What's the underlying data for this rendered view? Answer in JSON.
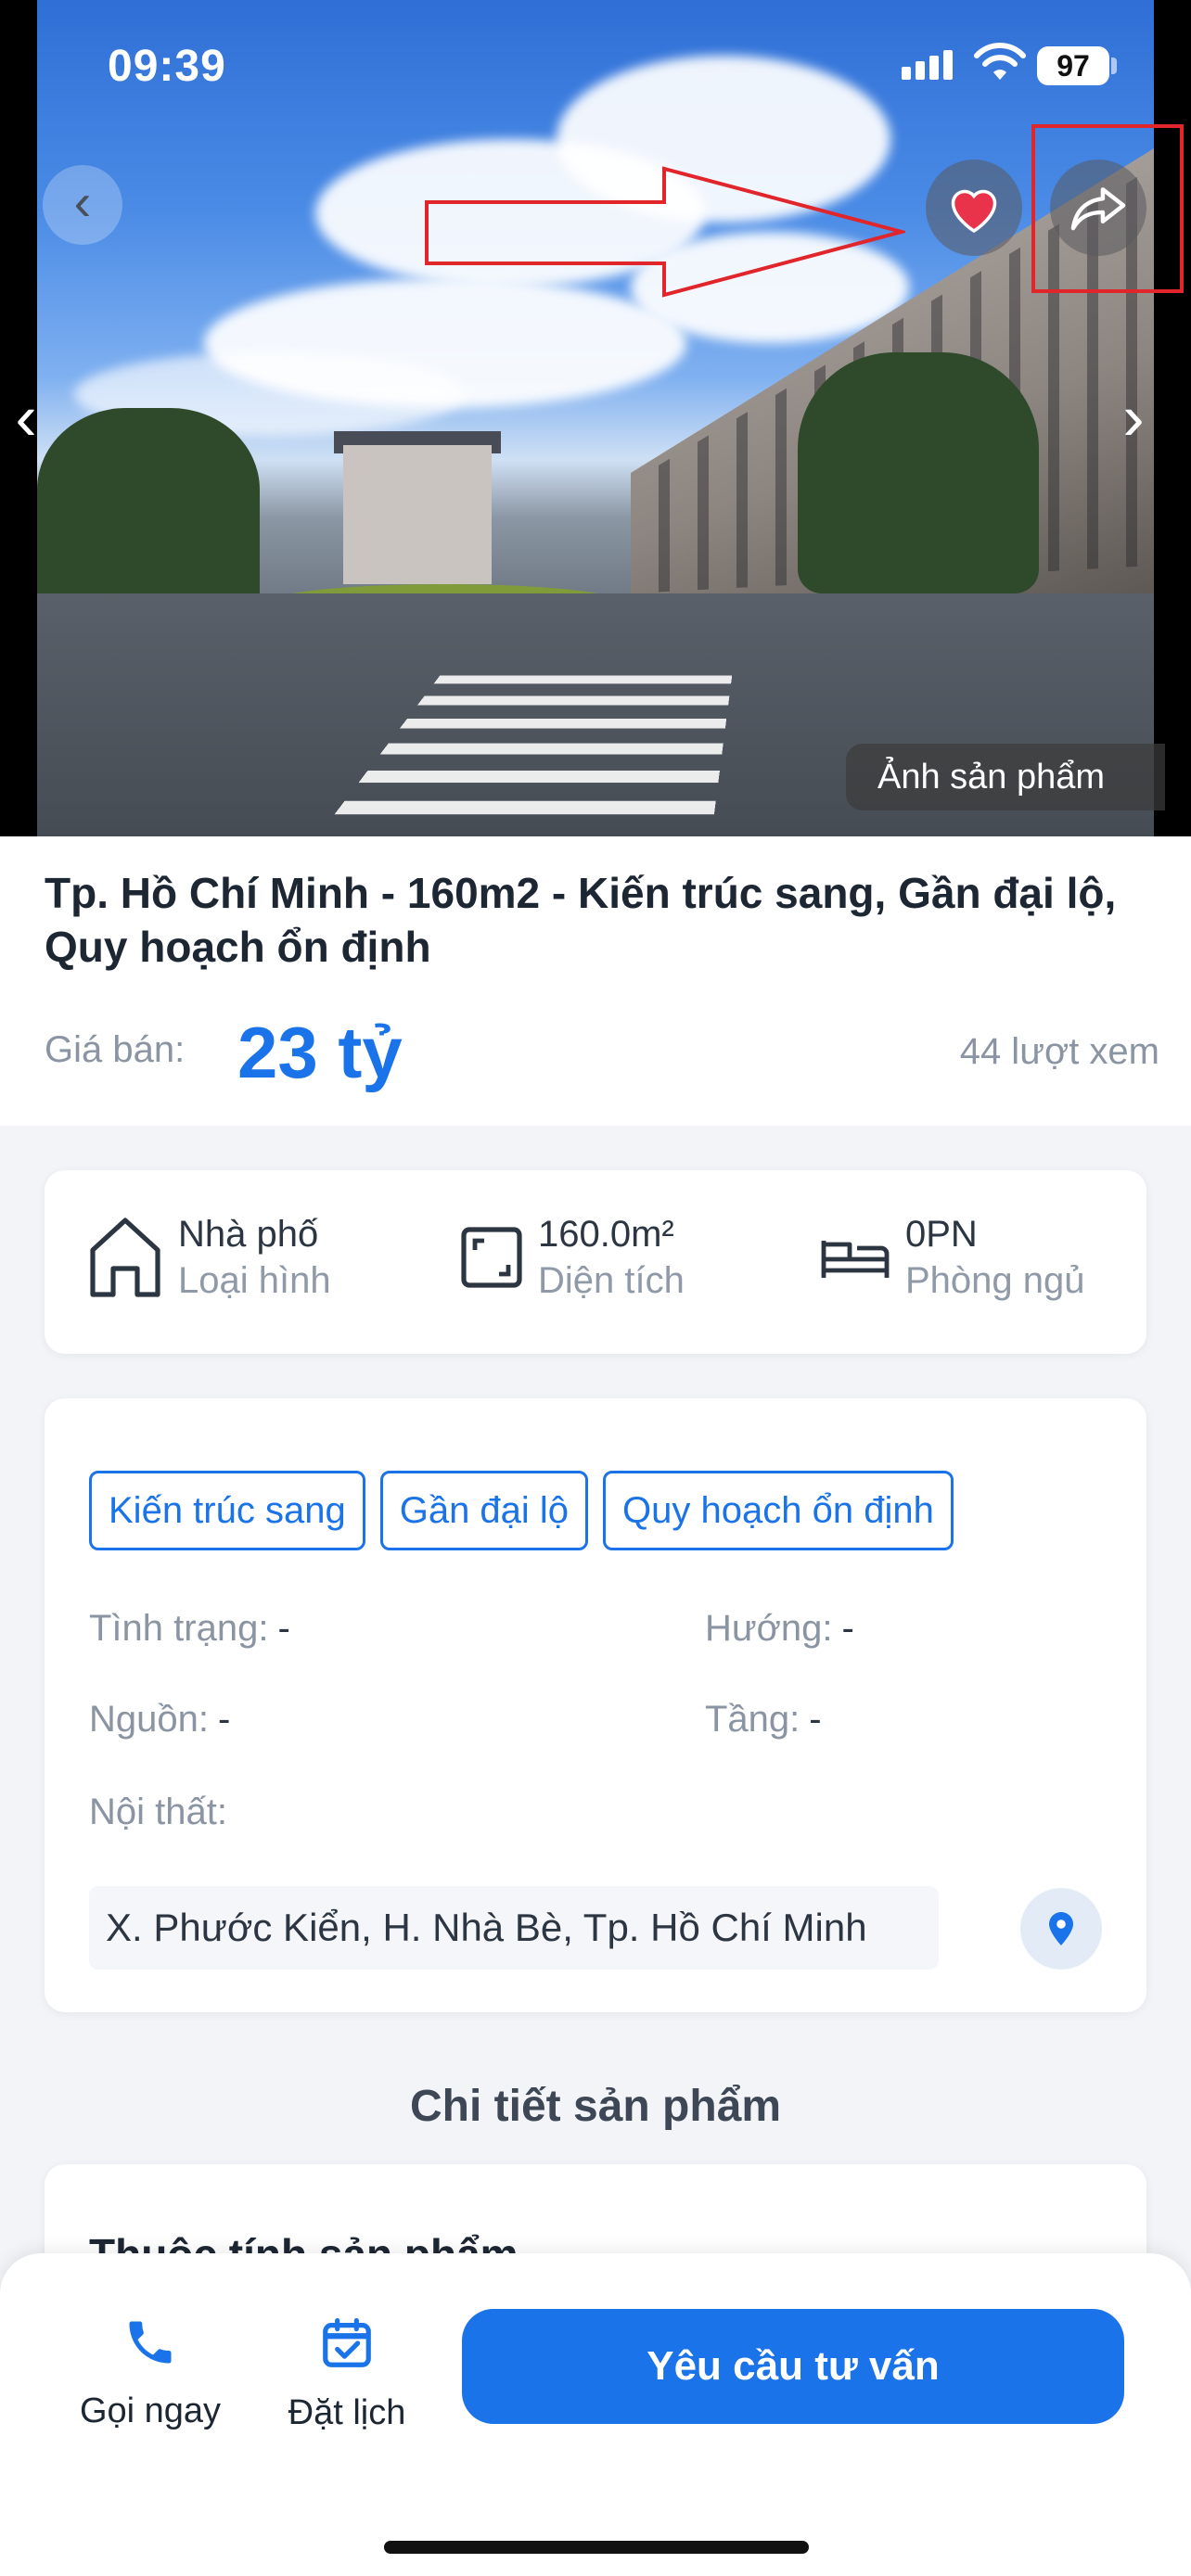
{
  "status_bar": {
    "time": "09:39",
    "battery": "97"
  },
  "hero": {
    "photo_label": "Ảnh sản phẩm"
  },
  "listing": {
    "title": "Tp. Hồ Chí Minh - 160m2 - Kiến trúc sang, Gần đại lộ, Quy hoạch ổn định",
    "price_label": "Giá bán:",
    "price": "23 tỷ",
    "views": "44 lượt xem"
  },
  "specs": [
    {
      "value": "Nhà phố",
      "label": "Loại hình",
      "icon": "house-icon"
    },
    {
      "value": "160.0m²",
      "label": "Diện tích",
      "icon": "area-icon"
    },
    {
      "value": "0PN",
      "label": "Phòng ngủ",
      "icon": "bed-icon"
    }
  ],
  "tags": [
    "Kiến trúc sang",
    "Gần đại lộ",
    "Quy hoạch ổn định"
  ],
  "attributes": {
    "status_label": "Tình trạng:",
    "status_value": "-",
    "direction_label": "Hướng:",
    "direction_value": "-",
    "source_label": "Nguồn:",
    "source_value": "-",
    "floor_label": "Tầng:",
    "floor_value": "-",
    "furniture_label": "Nội thất:"
  },
  "address": "X. Phước Kiển, H. Nhà Bè, Tp. Hồ Chí Minh",
  "section_title": "Chi tiết sản phẩm",
  "product_card_heading": "Thuộc tính sản phẩm",
  "bottom_bar": {
    "call_label": "Gọi ngay",
    "schedule_label": "Đặt lịch",
    "cta_label": "Yêu cầu tư vấn"
  },
  "colors": {
    "accent": "#1a73e8",
    "annotation": "#e0252b",
    "favorite": "#e8334a"
  }
}
